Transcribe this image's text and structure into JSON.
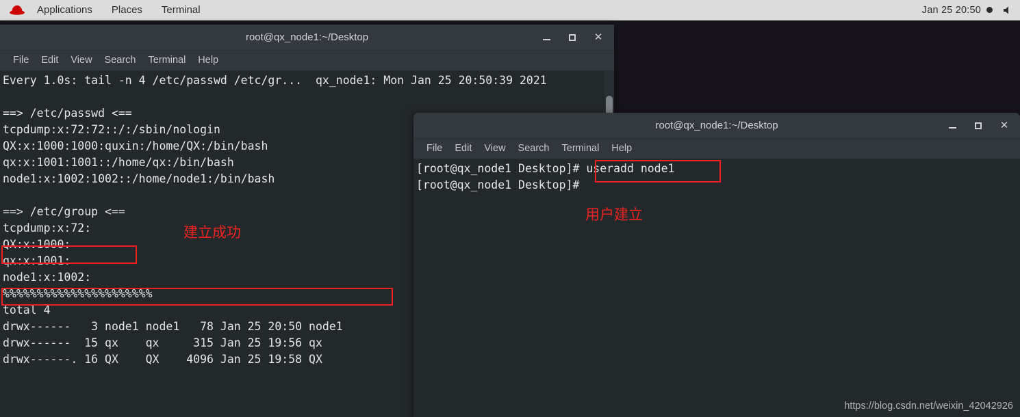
{
  "topbar": {
    "logo": "redhat-logo",
    "items": [
      {
        "label": "Applications"
      },
      {
        "label": "Places"
      },
      {
        "label": "Terminal"
      }
    ],
    "clock": "Jan 25  20:50",
    "recording_indicator": "●",
    "volume_icon": "volume-icon"
  },
  "window1": {
    "title": "root@qx_node1:~/Desktop",
    "menu": [
      "File",
      "Edit",
      "View",
      "Search",
      "Terminal",
      "Help"
    ],
    "buttons": {
      "minimize": "_",
      "maximize": "□",
      "close": "✕"
    },
    "content": "Every 1.0s: tail -n 4 /etc/passwd /etc/gr...  qx_node1: Mon Jan 25 20:50:39 2021\n\n==> /etc/passwd <==\ntcpdump:x:72:72::/:/sbin/nologin\nQX:x:1000:1000:quxin:/home/QX:/bin/bash\nqx:x:1001:1001::/home/qx:/bin/bash\nnode1:x:1002:1002::/home/node1:/bin/bash\n\n==> /etc/group <==\ntcpdump:x:72:\nQX:x:1000:\nqx:x:1001:\nnode1:x:1002:\n%%%%%%%%%%%%%%%%%%%%%%\ntotal 4\ndrwx------   3 node1 node1   78 Jan 25 20:50 node1\ndrwx------  15 qx    qx     315 Jan 25 19:56 qx\ndrwx------. 16 QX    QX    4096 Jan 25 19:58 QX",
    "annotation_label": "建立成功"
  },
  "window2": {
    "title": "root@qx_node1:~/Desktop",
    "menu": [
      "File",
      "Edit",
      "View",
      "Search",
      "Terminal",
      "Help"
    ],
    "buttons": {
      "minimize": "_",
      "maximize": "□",
      "close": "✕"
    },
    "content": "[root@qx_node1 Desktop]# useradd node1\n[root@qx_node1 Desktop]#",
    "annotation_label": "用户建立"
  },
  "watermark": "https://blog.csdn.net/weixin_42042926",
  "colors": {
    "annotation_red": "#f02020",
    "topbar_bg": "#dcdcdc",
    "titlebar_bg": "#33393f",
    "terminal_bg": "#23282b",
    "desktop_bg": "#17141c",
    "terminal_fg": "#e6e6e6"
  }
}
